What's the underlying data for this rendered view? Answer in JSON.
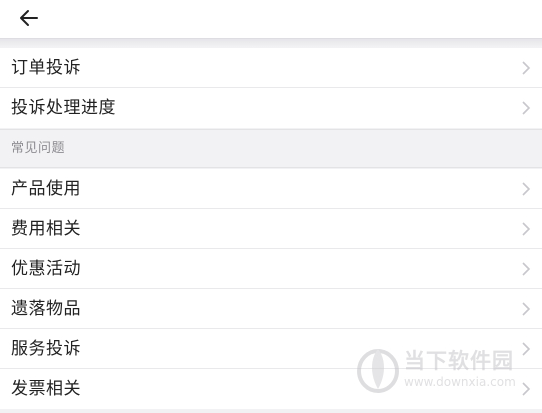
{
  "header": {
    "back_icon": "arrow-left-icon"
  },
  "group1": {
    "items": [
      {
        "label": "订单投诉"
      },
      {
        "label": "投诉处理进度"
      }
    ]
  },
  "faq": {
    "title": "常见问题",
    "items": [
      {
        "label": "产品使用"
      },
      {
        "label": "费用相关"
      },
      {
        "label": "优惠活动"
      },
      {
        "label": "遗落物品"
      },
      {
        "label": "服务投诉"
      },
      {
        "label": "发票相关"
      }
    ]
  },
  "watermark": {
    "title": "当下软件园",
    "url": "www.downxia.com"
  },
  "colors": {
    "background": "#f2f2f4",
    "text": "#222222",
    "section_text": "#8d8d92",
    "chevron": "#c7c7cc"
  }
}
